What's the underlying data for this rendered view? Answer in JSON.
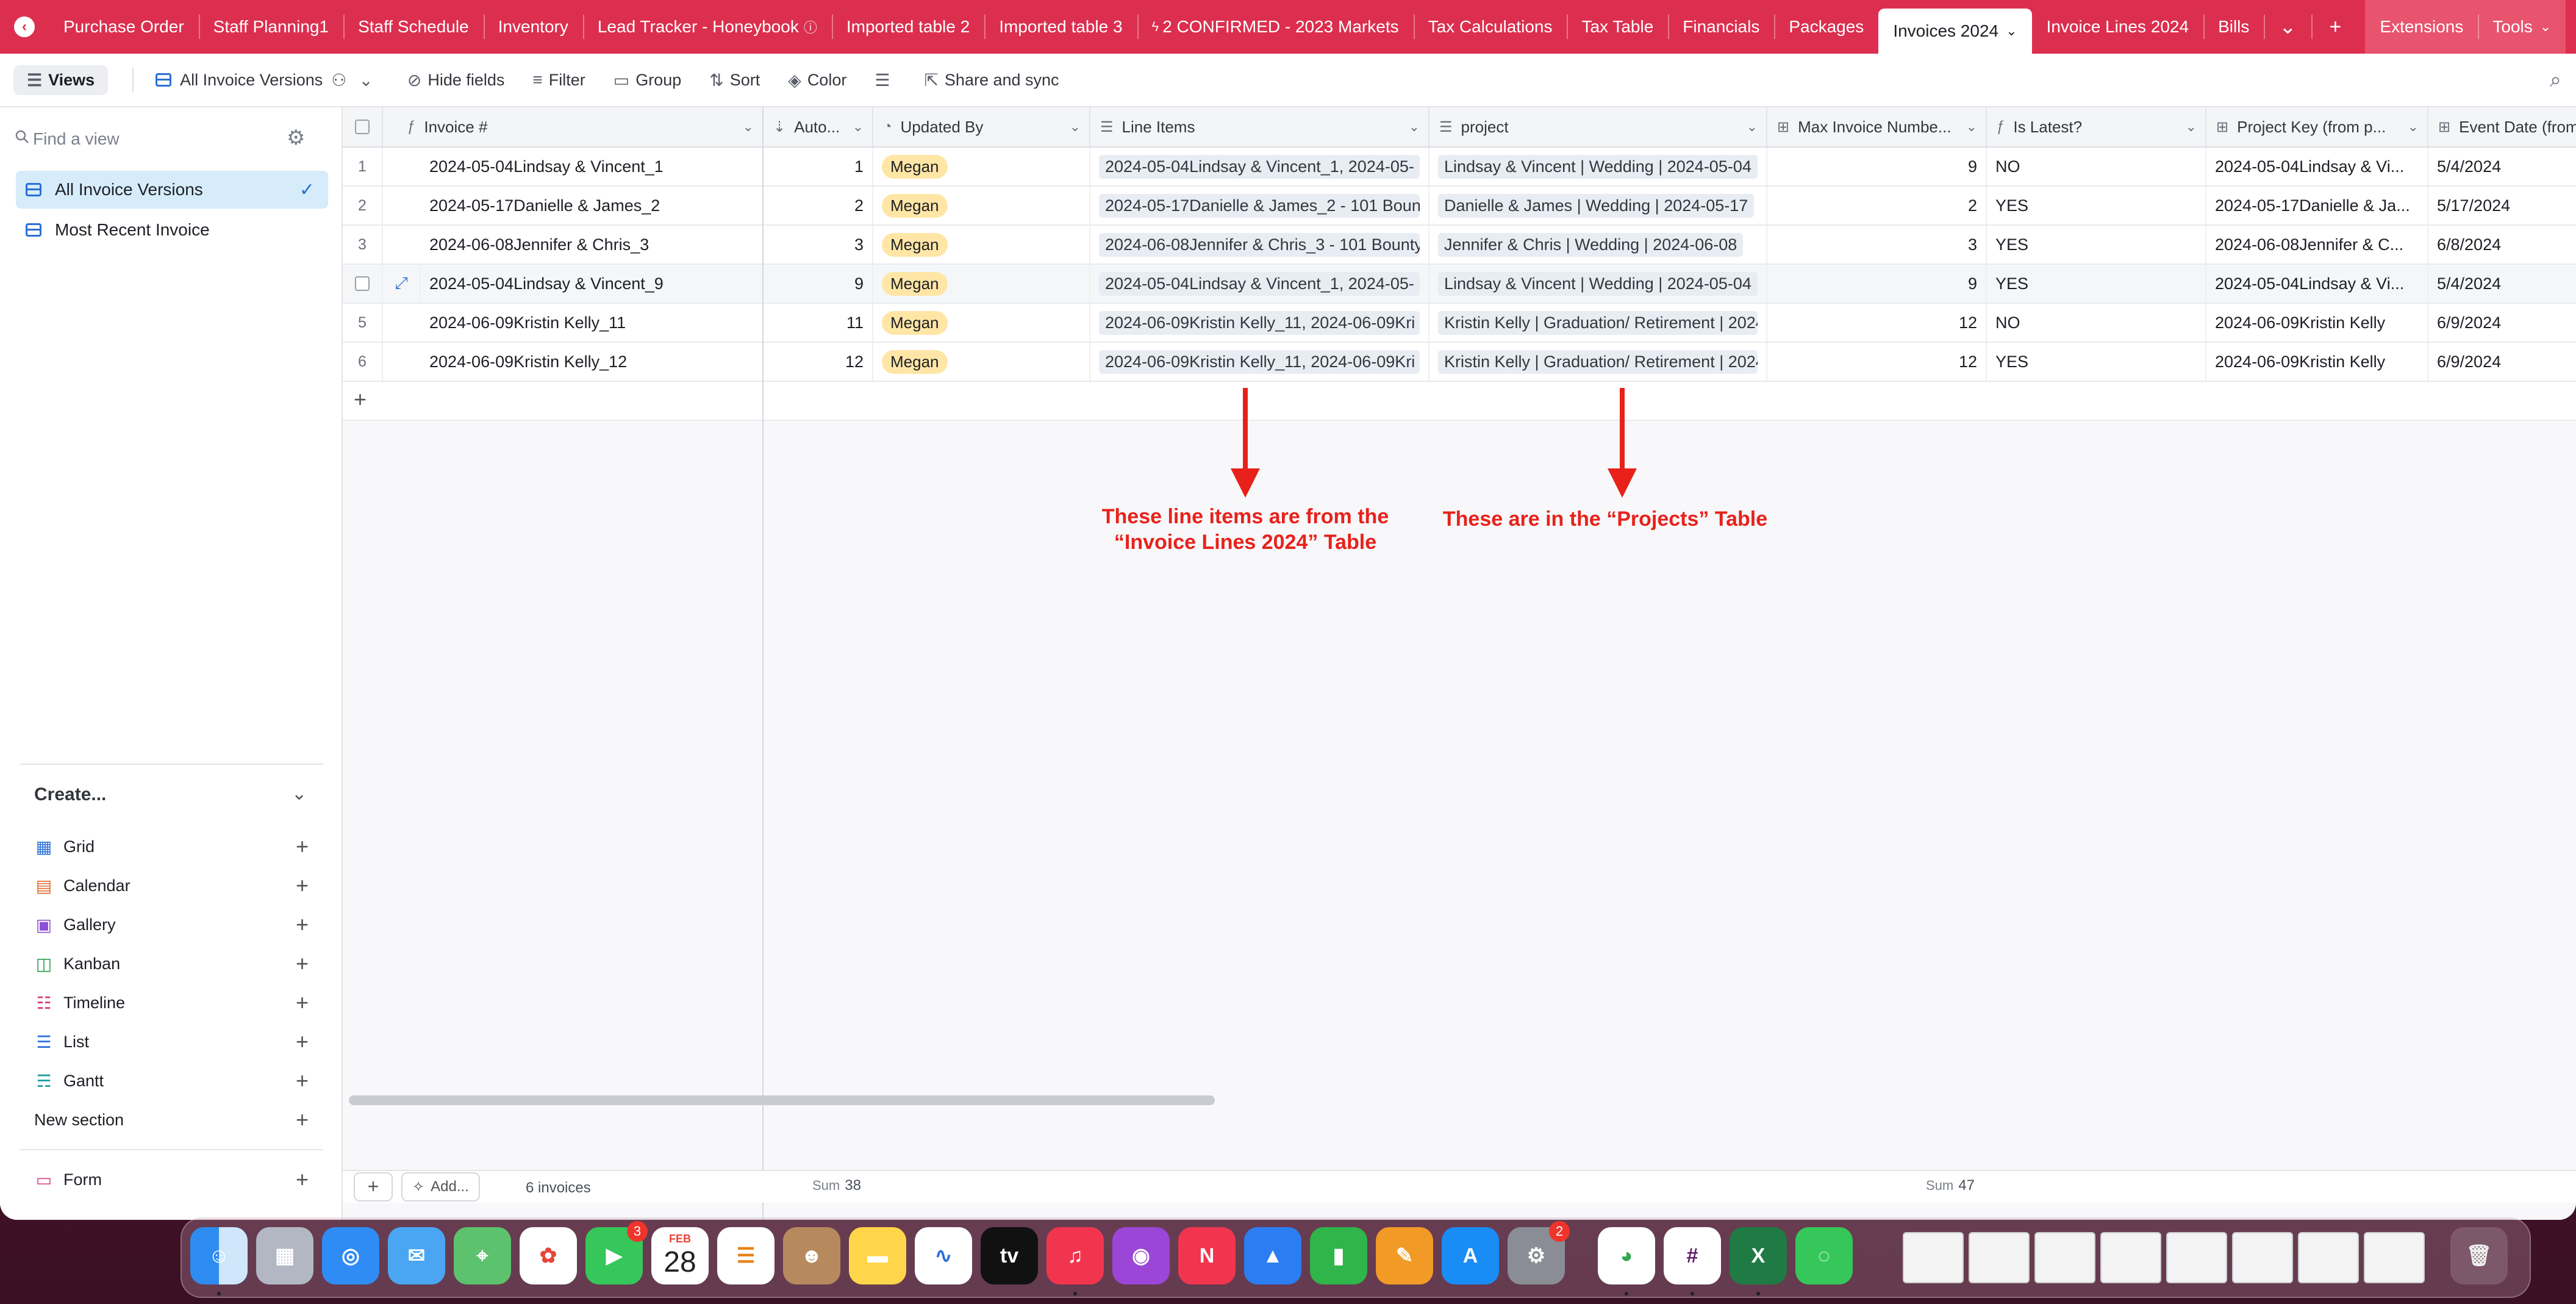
{
  "tabs": [
    {
      "label": "Purchase Order"
    },
    {
      "label": "Staff Planning1"
    },
    {
      "label": "Staff Schedule"
    },
    {
      "label": "Inventory"
    },
    {
      "label": "Lead Tracker - Honeybook"
    },
    {
      "label": "Imported table 2"
    },
    {
      "label": "Imported table 3"
    },
    {
      "label": "2 CONFIRMED - 2023 Markets"
    },
    {
      "label": "Tax Calculations"
    },
    {
      "label": "Tax Table"
    },
    {
      "label": "Financials"
    },
    {
      "label": "Packages"
    },
    {
      "label": "Invoices 2024"
    },
    {
      "label": "Invoice Lines 2024"
    },
    {
      "label": "Bills"
    }
  ],
  "top_right": {
    "extensions": "Extensions",
    "tools": "Tools"
  },
  "toolbar": {
    "views": "Views",
    "current_view": "All Invoice Versions",
    "hide_fields": "Hide fields",
    "filter": "Filter",
    "group": "Group",
    "sort": "Sort",
    "color": "Color",
    "share": "Share and sync"
  },
  "sidebar": {
    "find_placeholder": "Find a view",
    "views": [
      {
        "label": "All Invoice Versions"
      },
      {
        "label": "Most Recent Invoice"
      }
    ],
    "create_heading": "Create...",
    "create_items": [
      {
        "label": "Grid"
      },
      {
        "label": "Calendar"
      },
      {
        "label": "Gallery"
      },
      {
        "label": "Kanban"
      },
      {
        "label": "Timeline"
      },
      {
        "label": "List"
      },
      {
        "label": "Gantt"
      }
    ],
    "new_section": "New section",
    "form": "Form"
  },
  "table": {
    "columns": [
      "Invoice #",
      "Auto...",
      "Updated By",
      "Line Items",
      "project",
      "Max Invoice Numbe...",
      "Is Latest?",
      "Project Key (from p...",
      "Event Date (from"
    ],
    "rows": [
      {
        "n": "1",
        "invoice": "2024-05-04Lindsay & Vincent_1",
        "auto": "1",
        "by": "Megan",
        "lines": "2024-05-04Lindsay & Vincent_1, 2024-05-",
        "project": "Lindsay & Vincent | Wedding | 2024-05-04",
        "max": "9",
        "latest": "NO",
        "key": "2024-05-04Lindsay & Vi...",
        "date": "5/4/2024"
      },
      {
        "n": "2",
        "invoice": "2024-05-17Danielle & James_2",
        "auto": "2",
        "by": "Megan",
        "lines": "2024-05-17Danielle & James_2 - 101 Bount",
        "project": "Danielle & James | Wedding | 2024-05-17",
        "max": "2",
        "latest": "YES",
        "key": "2024-05-17Danielle & Ja...",
        "date": "5/17/2024"
      },
      {
        "n": "3",
        "invoice": "2024-06-08Jennifer & Chris_3",
        "auto": "3",
        "by": "Megan",
        "lines": "2024-06-08Jennifer & Chris_3 - 101 Bounty",
        "project": "Jennifer & Chris | Wedding | 2024-06-08",
        "max": "3",
        "latest": "YES",
        "key": "2024-06-08Jennifer & C...",
        "date": "6/8/2024"
      },
      {
        "n": "",
        "invoice": "2024-05-04Lindsay & Vincent_9",
        "auto": "9",
        "by": "Megan",
        "lines": "2024-05-04Lindsay & Vincent_1, 2024-05-",
        "project": "Lindsay & Vincent | Wedding | 2024-05-04",
        "max": "9",
        "latest": "YES",
        "key": "2024-05-04Lindsay & Vi...",
        "date": "5/4/2024"
      },
      {
        "n": "5",
        "invoice": "2024-06-09Kristin Kelly_11",
        "auto": "11",
        "by": "Megan",
        "lines": "2024-06-09Kristin Kelly_11, 2024-06-09Kri",
        "project": "Kristin Kelly | Graduation/ Retirement | 2024",
        "max": "12",
        "latest": "NO",
        "key": "2024-06-09Kristin Kelly",
        "date": "6/9/2024"
      },
      {
        "n": "6",
        "invoice": "2024-06-09Kristin Kelly_12",
        "auto": "12",
        "by": "Megan",
        "lines": "2024-06-09Kristin Kelly_11, 2024-06-09Kri",
        "project": "Kristin Kelly | Graduation/ Retirement | 2024",
        "max": "12",
        "latest": "YES",
        "key": "2024-06-09Kristin Kelly",
        "date": "6/9/2024"
      }
    ]
  },
  "footer": {
    "add": "Add...",
    "count": "6 invoices",
    "sum1_label": "Sum",
    "sum1_value": "38",
    "sum2_label": "Sum",
    "sum2_value": "47"
  },
  "annotations": {
    "left": "These line items are from the “Invoice Lines 2024” Table",
    "right": "These are in the “Projects” Table",
    "color": "#e8211b"
  },
  "dock": {
    "calendar_month": "FEB",
    "calendar_day": "28",
    "facetime_badge": "3",
    "settings_badge": "2"
  },
  "colors": {
    "tabbar": "#dc2f4f",
    "accent": "#2b6fd6",
    "pill": "#ffe6a6"
  }
}
